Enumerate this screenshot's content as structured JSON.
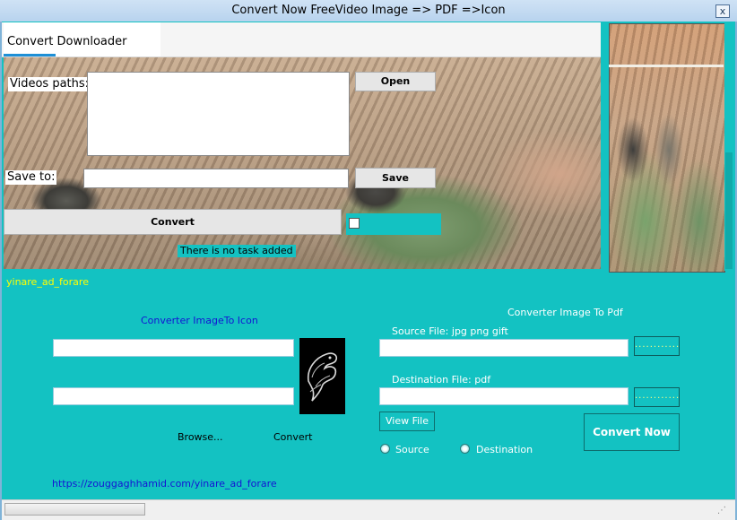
{
  "window": {
    "title": "Convert Now FreeVideo  Image => PDF =>Icon",
    "close_glyph": "x"
  },
  "tab": {
    "label": "Convert  Downloader"
  },
  "downloader": {
    "videos_label": "Videos paths:",
    "videos_value": "",
    "open_button": "Open",
    "save_label": "Save to:",
    "save_value": "",
    "save_button": "Save",
    "convert_button": "Convert",
    "checkbox_checked": false,
    "status": "There is no task added"
  },
  "brand": "yinare_ad_forare",
  "icon_converter": {
    "title": "Converter   ImageTo  Icon",
    "input1": "",
    "input2": "",
    "logo_icon": "eagle-emblem-icon",
    "browse_button": "Browse...",
    "convert_button": "Convert"
  },
  "pdf_converter": {
    "title": "Converter   Image  To Pdf",
    "source_label": "Source File: jpg png gift",
    "source_value": "",
    "source_browse": "............",
    "dest_label": "Destination File: pdf",
    "dest_value": "",
    "dest_browse": "............",
    "view_file_button": "View File",
    "convert_now_button": "Convert Now",
    "radio_source": "Source",
    "radio_destination": "Destination"
  },
  "link": "https://zouggaghhamid.com/yinare_ad_forare",
  "colors": {
    "accent": "#13c2c2",
    "link": "#1414d4",
    "brand": "#ffff00"
  }
}
